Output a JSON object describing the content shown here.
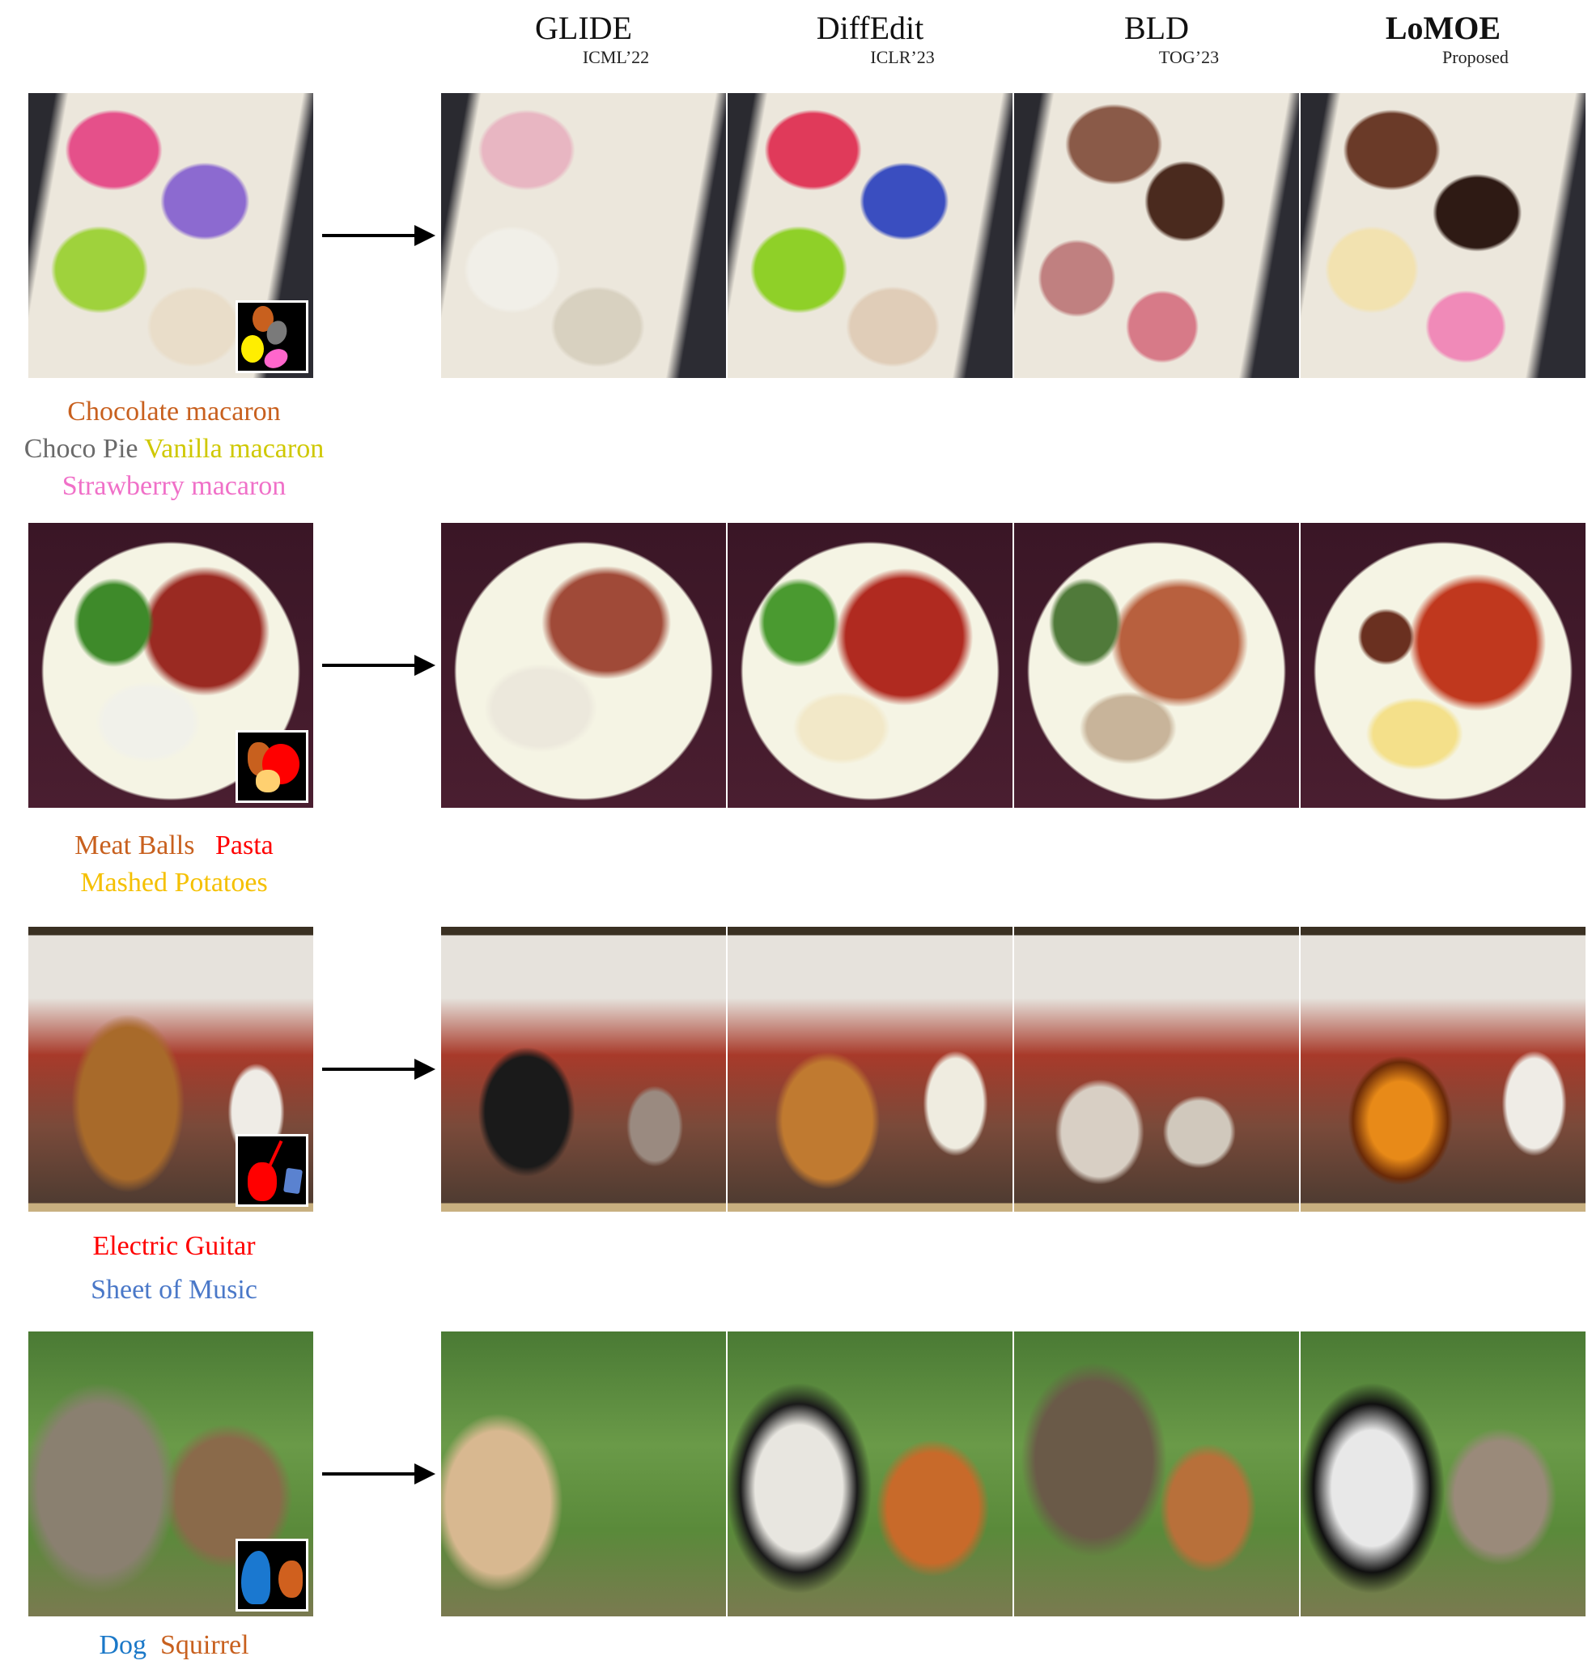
{
  "headers": [
    {
      "name": "GLIDE",
      "venue": "ICML’22",
      "bold": false
    },
    {
      "name": "DiffEdit",
      "venue": "ICLR’23",
      "bold": false
    },
    {
      "name": "BLD",
      "venue": "TOG’23",
      "bold": false
    },
    {
      "name": "LoMOE",
      "venue": "Proposed",
      "bold": true
    }
  ],
  "rows": [
    {
      "id": "macarons",
      "input_image": "macarons-on-tray",
      "mask_icon": "segmentation-mask",
      "arrow_icon": "right-arrow",
      "label_lines": [
        [
          {
            "text": "Chocolate macaron",
            "color": "#c8601e"
          }
        ],
        [
          {
            "text": "Choco Pie ",
            "color": "#6a6a6a"
          },
          {
            "text": "Vanilla macaron",
            "color": "#cfc800"
          }
        ],
        [
          {
            "text": "Strawberry macaron",
            "color": "#f070c8"
          }
        ]
      ],
      "mask_colors": [
        "#c8601e",
        "#7a7a7a",
        "#ffee00",
        "#ff66cc"
      ],
      "results": [
        "glide-macarons",
        "diffedit-macarons",
        "bld-macarons",
        "lomoe-macarons"
      ]
    },
    {
      "id": "bowl",
      "input_image": "pasta-bowl",
      "mask_icon": "segmentation-mask",
      "arrow_icon": "right-arrow",
      "label_lines": [
        [
          {
            "text": "Meat Balls   ",
            "color": "#c8601e"
          },
          {
            "text": "Pasta",
            "color": "#ff0000"
          }
        ],
        [
          {
            "text": "Mashed Potatoes",
            "color": "#f5c000"
          }
        ]
      ],
      "mask_colors": [
        "#c8601e",
        "#ff0000",
        "#ffd070"
      ],
      "results": [
        "glide-bowl",
        "diffedit-bowl",
        "bld-bowl",
        "lomoe-bowl"
      ]
    },
    {
      "id": "music",
      "input_image": "cello-and-sheet-music",
      "mask_icon": "segmentation-mask",
      "arrow_icon": "right-arrow",
      "label_lines": [
        [
          {
            "text": "Electric Guitar",
            "color": "#ff0000"
          }
        ],
        [
          {
            "text": "Sheet of Music",
            "color": "#4a78c8"
          }
        ]
      ],
      "mask_colors": [
        "#ff0000",
        "#5a82d0"
      ],
      "results": [
        "glide-music",
        "diffedit-music",
        "bld-music",
        "lomoe-music"
      ]
    },
    {
      "id": "garden",
      "input_image": "kitten-and-rabbit",
      "mask_icon": "segmentation-mask",
      "arrow_icon": "right-arrow",
      "label_lines": [
        [
          {
            "text": "Dog  ",
            "color": "#1a78c8"
          },
          {
            "text": "Squirrel",
            "color": "#c8601e"
          }
        ]
      ],
      "mask_colors": [
        "#1a78d0",
        "#d0601e"
      ],
      "results": [
        "glide-garden",
        "diffedit-garden",
        "bld-garden",
        "lomoe-garden"
      ]
    }
  ]
}
